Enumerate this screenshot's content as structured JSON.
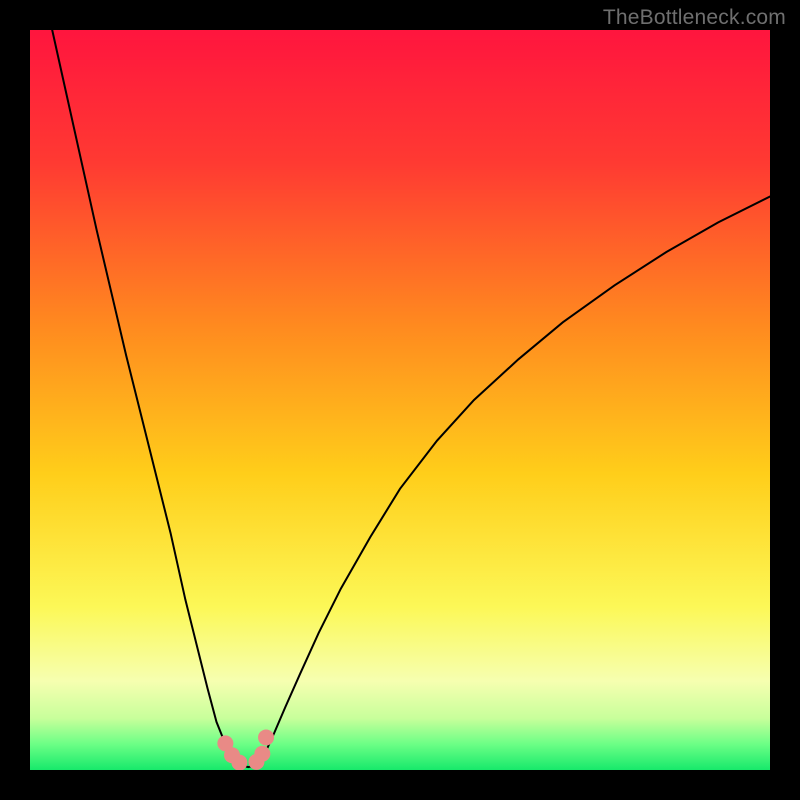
{
  "watermark": "TheBottleneck.com",
  "colors": {
    "gradient_stops": [
      {
        "offset": 0.0,
        "color": "#ff153e"
      },
      {
        "offset": 0.18,
        "color": "#ff3a32"
      },
      {
        "offset": 0.4,
        "color": "#ff8a1f"
      },
      {
        "offset": 0.6,
        "color": "#ffce1a"
      },
      {
        "offset": 0.78,
        "color": "#fcf857"
      },
      {
        "offset": 0.88,
        "color": "#f6ffb0"
      },
      {
        "offset": 0.93,
        "color": "#c8ff9b"
      },
      {
        "offset": 0.965,
        "color": "#6cff86"
      },
      {
        "offset": 1.0,
        "color": "#17e96b"
      }
    ],
    "curve": "#000000",
    "marker_fill": "#e98a86",
    "marker_stroke": "#c55a58"
  },
  "chart_data": {
    "type": "line",
    "title": "",
    "xlabel": "",
    "ylabel": "",
    "xlim": [
      0,
      100
    ],
    "ylim": [
      0,
      100
    ],
    "series": [
      {
        "name": "left-branch",
        "x": [
          3,
          5,
          7,
          9,
          11,
          13,
          15,
          17,
          19,
          21,
          22.5,
          24,
          25.2,
          26.2,
          27,
          27.8
        ],
        "y": [
          100,
          91,
          82,
          73,
          64.5,
          56,
          48,
          40,
          32,
          23,
          17,
          11,
          6.5,
          4,
          2.3,
          1.2
        ]
      },
      {
        "name": "right-branch",
        "x": [
          31.2,
          32,
          33,
          34.5,
          36.5,
          39,
          42,
          46,
          50,
          55,
          60,
          66,
          72,
          79,
          86,
          93,
          100
        ],
        "y": [
          1.4,
          2.8,
          5,
          8.5,
          13,
          18.5,
          24.5,
          31.5,
          38,
          44.5,
          50,
          55.5,
          60.5,
          65.5,
          70,
          74,
          77.5
        ]
      },
      {
        "name": "floor",
        "x": [
          27.8,
          28.6,
          29.5,
          30.4,
          31.2
        ],
        "y": [
          1.2,
          0.6,
          0.4,
          0.6,
          1.4
        ]
      }
    ],
    "markers": {
      "name": "highlighted-points",
      "x": [
        26.4,
        27.3,
        28.3,
        30.6,
        31.4,
        31.9
      ],
      "y": [
        3.6,
        2.0,
        1.0,
        1.1,
        2.2,
        4.4
      ]
    }
  }
}
